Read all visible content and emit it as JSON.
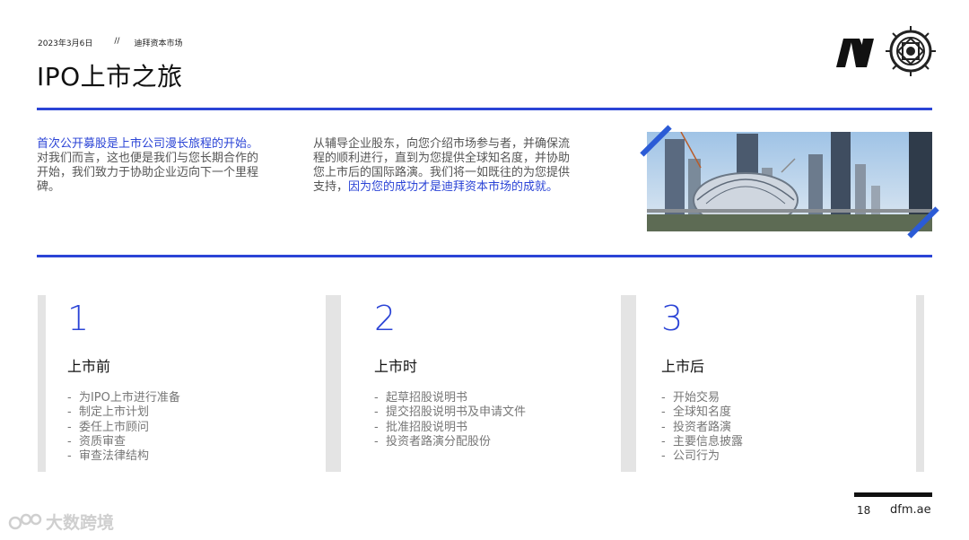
{
  "header": {
    "date": "2023年3月6日",
    "separator": "//",
    "org": "迪拜资本市场",
    "title": "IPO上市之旅"
  },
  "intro": {
    "col1_highlight": "首次公开募股是上市公司漫长旅程的开始。",
    "col1_body": "对我们而言，这也便是我们与您长期合作的开始，我们致力于协助企业迈向下一个里程碑。",
    "col2_body": "从辅导企业股东，向您介绍市场参与者，并确保流程的顺利进行，直到为您提供全球知名度，并协助您上市后的国际路演。我们将一如既往的为您提供支持，",
    "col2_highlight": "因为您的成功才是迪拜资本市场的成就。"
  },
  "stages": [
    {
      "number": "1",
      "heading": "上市前",
      "items": [
        "为IPO上市进行准备",
        "制定上市计划",
        "委任上市顾问",
        "资质审查",
        "审查法律结构"
      ]
    },
    {
      "number": "2",
      "heading": "上市时",
      "items": [
        "起草招股说明书",
        "提交招股说明书及申请文件",
        "批准招股说明书",
        "投资者路演分配股份"
      ]
    },
    {
      "number": "3",
      "heading": "上市后",
      "items": [
        "开始交易",
        "全球知名度",
        "投资者路演",
        "主要信息披露",
        "公司行为"
      ]
    }
  ],
  "footer": {
    "page_number": "18",
    "site": "dfm.ae"
  },
  "watermark": {
    "text": "大数跨境"
  },
  "colors": {
    "accent": "#2b44d6",
    "card_border": "#e4e4e4",
    "muted_text": "#777777"
  },
  "icons": {
    "brand_logo": "dfm-logo-icon",
    "seal": "seal-emblem-icon",
    "watermark": "watermark-logo-icon"
  }
}
